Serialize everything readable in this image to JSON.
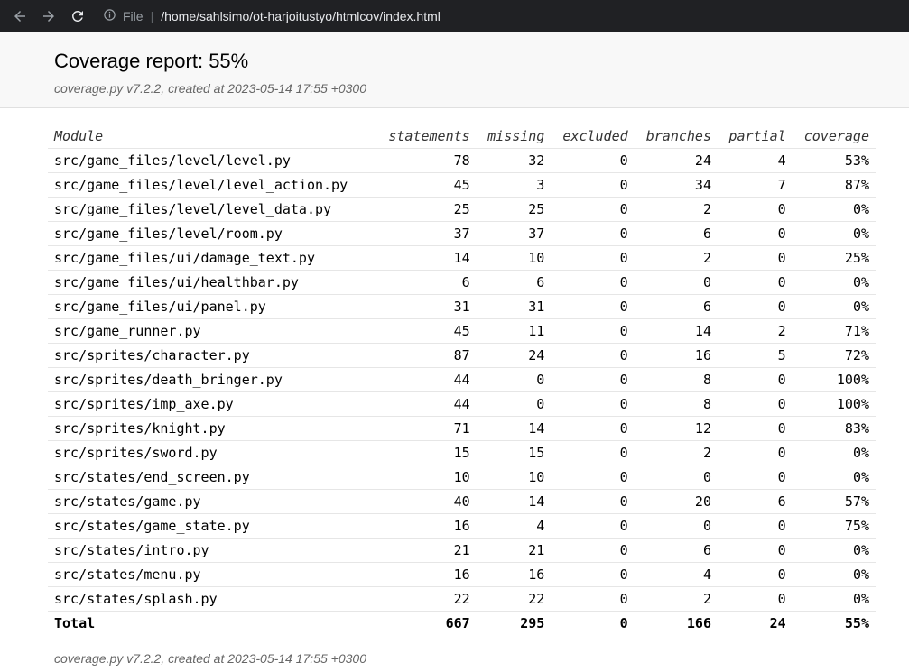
{
  "browser": {
    "scheme": "File",
    "url": "/home/sahlsimo/ot-harjoitustyo/htmlcov/index.html"
  },
  "header": {
    "title": "Coverage report: 55%",
    "meta": "coverage.py v7.2.2, created at 2023-05-14 17:55 +0300"
  },
  "table": {
    "columns": [
      "Module",
      "statements",
      "missing",
      "excluded",
      "branches",
      "partial",
      "coverage"
    ],
    "rows": [
      [
        "src/game_files/level/level.py",
        "78",
        "32",
        "0",
        "24",
        "4",
        "53%"
      ],
      [
        "src/game_files/level/level_action.py",
        "45",
        "3",
        "0",
        "34",
        "7",
        "87%"
      ],
      [
        "src/game_files/level/level_data.py",
        "25",
        "25",
        "0",
        "2",
        "0",
        "0%"
      ],
      [
        "src/game_files/level/room.py",
        "37",
        "37",
        "0",
        "6",
        "0",
        "0%"
      ],
      [
        "src/game_files/ui/damage_text.py",
        "14",
        "10",
        "0",
        "2",
        "0",
        "25%"
      ],
      [
        "src/game_files/ui/healthbar.py",
        "6",
        "6",
        "0",
        "0",
        "0",
        "0%"
      ],
      [
        "src/game_files/ui/panel.py",
        "31",
        "31",
        "0",
        "6",
        "0",
        "0%"
      ],
      [
        "src/game_runner.py",
        "45",
        "11",
        "0",
        "14",
        "2",
        "71%"
      ],
      [
        "src/sprites/character.py",
        "87",
        "24",
        "0",
        "16",
        "5",
        "72%"
      ],
      [
        "src/sprites/death_bringer.py",
        "44",
        "0",
        "0",
        "8",
        "0",
        "100%"
      ],
      [
        "src/sprites/imp_axe.py",
        "44",
        "0",
        "0",
        "8",
        "0",
        "100%"
      ],
      [
        "src/sprites/knight.py",
        "71",
        "14",
        "0",
        "12",
        "0",
        "83%"
      ],
      [
        "src/sprites/sword.py",
        "15",
        "15",
        "0",
        "2",
        "0",
        "0%"
      ],
      [
        "src/states/end_screen.py",
        "10",
        "10",
        "0",
        "0",
        "0",
        "0%"
      ],
      [
        "src/states/game.py",
        "40",
        "14",
        "0",
        "20",
        "6",
        "57%"
      ],
      [
        "src/states/game_state.py",
        "16",
        "4",
        "0",
        "0",
        "0",
        "75%"
      ],
      [
        "src/states/intro.py",
        "21",
        "21",
        "0",
        "6",
        "0",
        "0%"
      ],
      [
        "src/states/menu.py",
        "16",
        "16",
        "0",
        "4",
        "0",
        "0%"
      ],
      [
        "src/states/splash.py",
        "22",
        "22",
        "0",
        "2",
        "0",
        "0%"
      ]
    ],
    "total": [
      "Total",
      "667",
      "295",
      "0",
      "166",
      "24",
      "55%"
    ]
  },
  "footer": {
    "meta": "coverage.py v7.2.2, created at 2023-05-14 17:55 +0300"
  }
}
